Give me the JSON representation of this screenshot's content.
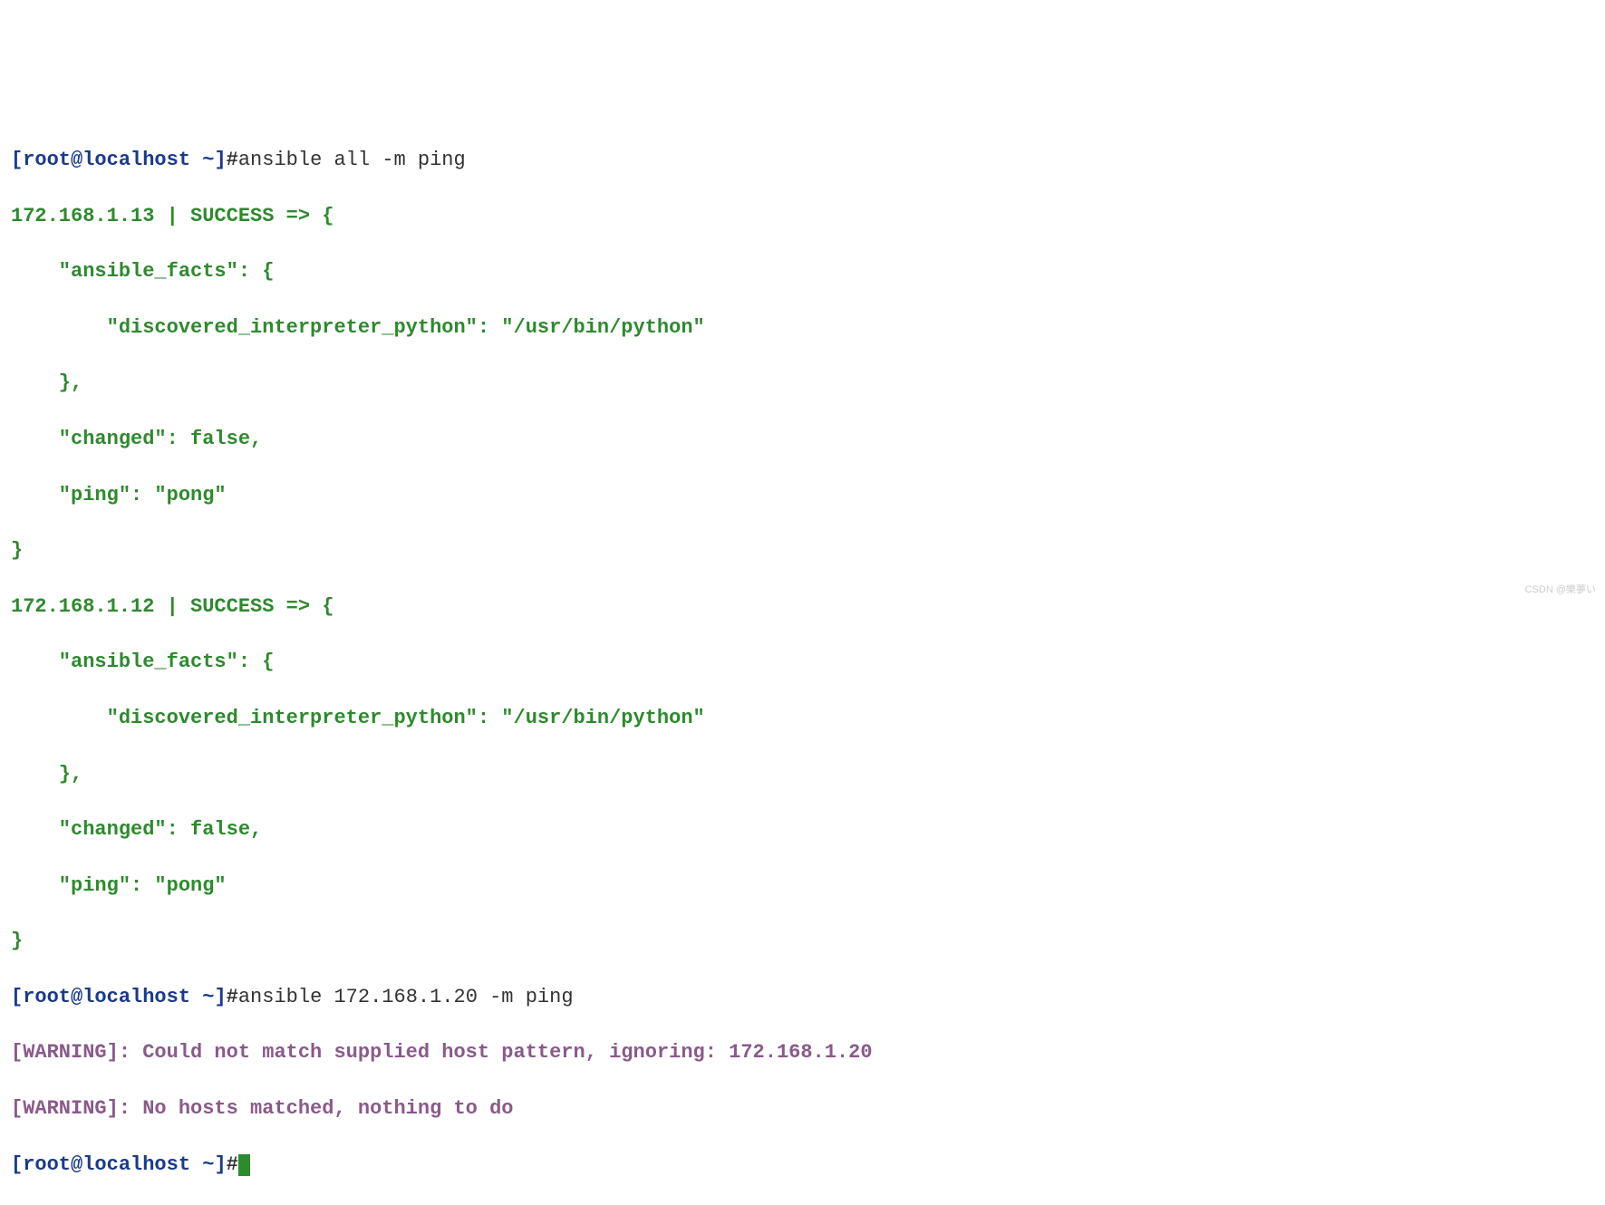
{
  "prompt": {
    "open_bracket": "[",
    "user": "root",
    "at": "@",
    "host": "localhost",
    "space": " ",
    "path": "~",
    "close_bracket": "]",
    "hash": "#"
  },
  "commands": {
    "cmd1": "ansible all -m ping",
    "cmd2": "ansible 172.168.1.20 -m ping"
  },
  "results": {
    "host1": {
      "header": "172.168.1.13 | SUCCESS => {",
      "facts_open": "    \"ansible_facts\": {",
      "interpreter": "        \"discovered_interpreter_python\": \"/usr/bin/python\"",
      "facts_close": "    },",
      "changed": "    \"changed\": false,",
      "ping": "    \"ping\": \"pong\"",
      "close": "}"
    },
    "host2": {
      "header": "172.168.1.12 | SUCCESS => {",
      "facts_open": "    \"ansible_facts\": {",
      "interpreter": "        \"discovered_interpreter_python\": \"/usr/bin/python\"",
      "facts_close": "    },",
      "changed": "    \"changed\": false,",
      "ping": "    \"ping\": \"pong\"",
      "close": "}"
    }
  },
  "warnings": {
    "w1": "[WARNING]: Could not match supplied host pattern, ignoring: 172.168.1.20",
    "w2": "[WARNING]: No hosts matched, nothing to do"
  },
  "watermark": "CSDN @樂夢い"
}
